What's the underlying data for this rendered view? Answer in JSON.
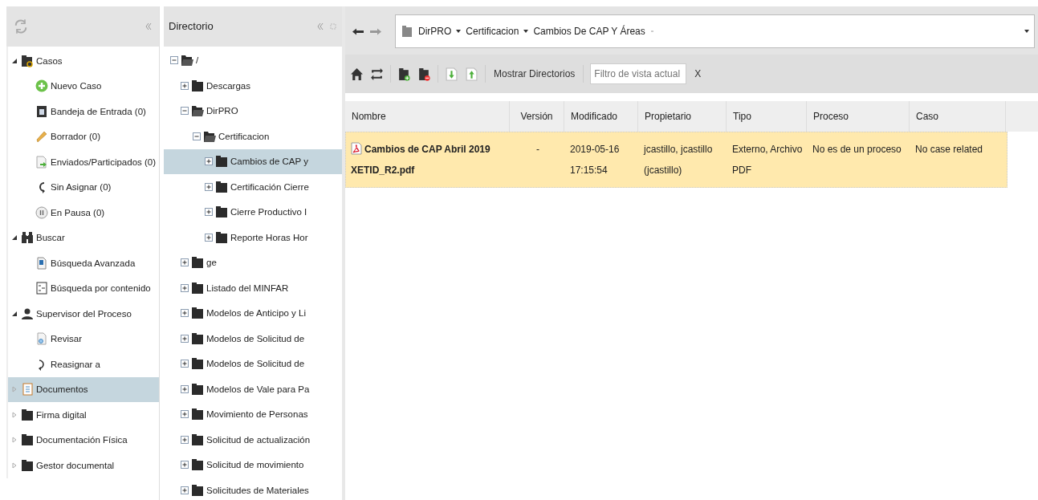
{
  "nav": [
    {
      "label": "Casos",
      "kind": "cases",
      "expanded": true,
      "selected": false,
      "children": [
        {
          "label": "Nuevo Caso",
          "kind": "new",
          "selected": false
        },
        {
          "label": "Bandeja de Entrada (0)",
          "kind": "inbox",
          "selected": false
        },
        {
          "label": "Borrador (0)",
          "kind": "draft",
          "selected": false
        },
        {
          "label": "Enviados/Participados (0)",
          "kind": "sent",
          "selected": false
        },
        {
          "label": "Sin Asignar (0)",
          "kind": "unassigned",
          "selected": false
        },
        {
          "label": "En Pausa (0)",
          "kind": "paused",
          "selected": false
        }
      ]
    },
    {
      "label": "Buscar",
      "kind": "search",
      "expanded": true,
      "selected": false,
      "children": [
        {
          "label": "Búsqueda Avanzada",
          "kind": "advanced",
          "selected": false
        },
        {
          "label": "Búsqueda por contenido",
          "kind": "content",
          "selected": false
        }
      ]
    },
    {
      "label": "Supervisor del Proceso",
      "kind": "supervisor",
      "expanded": true,
      "selected": false,
      "children": [
        {
          "label": "Revisar",
          "kind": "review",
          "selected": false
        },
        {
          "label": "Reasignar a",
          "kind": "reassign",
          "selected": false
        }
      ]
    },
    {
      "label": "Documentos",
      "kind": "documents",
      "expanded": false,
      "selected": true
    },
    {
      "label": "Firma digital",
      "kind": "folder",
      "expanded": false,
      "selected": false
    },
    {
      "label": "Documentación Física",
      "kind": "folder",
      "expanded": false,
      "selected": false
    },
    {
      "label": "Gestor documental",
      "kind": "folder",
      "expanded": false,
      "selected": false
    }
  ],
  "directory": {
    "title": "Directorio",
    "tree": [
      {
        "label": "/",
        "expanded": true,
        "selected": false,
        "children": [
          {
            "label": "Descargas",
            "expanded": false,
            "selected": false
          },
          {
            "label": "DirPRO",
            "expanded": true,
            "selected": false,
            "children": [
              {
                "label": "Certificacion",
                "expanded": true,
                "selected": false,
                "children": [
                  {
                    "label": "Cambios de CAP y",
                    "expanded": false,
                    "selected": true
                  },
                  {
                    "label": "Certificación Cierre",
                    "expanded": false,
                    "selected": false
                  },
                  {
                    "label": "Cierre Productivo I",
                    "expanded": false,
                    "selected": false
                  },
                  {
                    "label": "Reporte Horas Hor",
                    "expanded": false,
                    "selected": false
                  }
                ]
              }
            ]
          },
          {
            "label": "ge",
            "expanded": false,
            "selected": false
          },
          {
            "label": "Listado del MINFAR",
            "expanded": false,
            "selected": false
          },
          {
            "label": "Modelos de Anticipo y Li",
            "expanded": false,
            "selected": false
          },
          {
            "label": "Modelos de Solicitud de",
            "expanded": false,
            "selected": false
          },
          {
            "label": "Modelos de Solicitud de",
            "expanded": false,
            "selected": false
          },
          {
            "label": "Modelos de Vale para Pa",
            "expanded": false,
            "selected": false
          },
          {
            "label": "Movimiento de Personas",
            "expanded": false,
            "selected": false
          },
          {
            "label": "Solicitud de actualización",
            "expanded": false,
            "selected": false
          },
          {
            "label": "Solicitud de movimiento",
            "expanded": false,
            "selected": false
          },
          {
            "label": "Solicitudes de Materiales",
            "expanded": false,
            "selected": false
          }
        ]
      }
    ]
  },
  "breadcrumb": [
    "DirPRO",
    "Certificacion",
    "Cambios De CAP Y Áreas"
  ],
  "toolbar": {
    "show_dirs": "Mostrar Directorios",
    "filter_placeholder": "Filtro de vista actual",
    "clear": "X"
  },
  "table": {
    "columns": [
      "Nombre",
      "Versión",
      "Modificado",
      "Propietario",
      "Tipo",
      "Proceso",
      "Caso"
    ],
    "rows": [
      {
        "selected": true,
        "cells": [
          "Cambios de CAP Abril 2019 XETID_R2.pdf",
          "-",
          "2019-05-16 17:15:54",
          "jcastillo, jcastillo (jcastillo)",
          "Externo, Archivo PDF",
          "No es de un proceso",
          "No case related"
        ]
      }
    ]
  }
}
